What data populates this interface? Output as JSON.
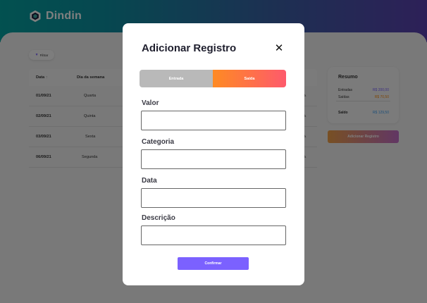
{
  "app": {
    "brand_name": "Dindin",
    "logo_icon": "hexagon-logo-icon"
  },
  "toolbar": {
    "filter_label": "Filtrar",
    "filter_icon": "filter-icon"
  },
  "table": {
    "headers": {
      "date": "Data",
      "date_sort_indicator": "↑",
      "weekday": "Dia da semana"
    },
    "rows": [
      {
        "date": "01/09/21",
        "weekday": "Quarta"
      },
      {
        "date": "02/09/21",
        "weekday": "Quinta"
      },
      {
        "date": "03/09/21",
        "weekday": "Sexta"
      },
      {
        "date": "06/09/21",
        "weekday": "Segunda"
      }
    ],
    "edit_icon": "pencil-icon"
  },
  "summary": {
    "title": "Resumo",
    "income_label": "Entradas",
    "income_value": "R$ 200,00",
    "expense_label": "Saídas",
    "expense_value": "R$ 70,50",
    "balance_label": "Saldo",
    "balance_value": "R$ 129,50"
  },
  "actions": {
    "add_record_label": "Adicionar Registro"
  },
  "modal": {
    "title": "Adicionar Registro",
    "close_symbol": "✕",
    "toggle": {
      "income_label": "Entrada",
      "expense_label": "Saída",
      "selected": "Saída"
    },
    "fields": {
      "value_label": "Valor",
      "value_value": "",
      "category_label": "Categoria",
      "category_value": "",
      "date_label": "Data",
      "date_value": "",
      "description_label": "Descrição",
      "description_value": ""
    },
    "confirm_label": "Confirmar"
  },
  "colors": {
    "accent": "#7b61ff",
    "income": "#7b61ff",
    "expense": "#fa8c10",
    "balance": "#3a9ff1",
    "header_start": "#05a2a0",
    "header_end": "#5b41b0"
  }
}
